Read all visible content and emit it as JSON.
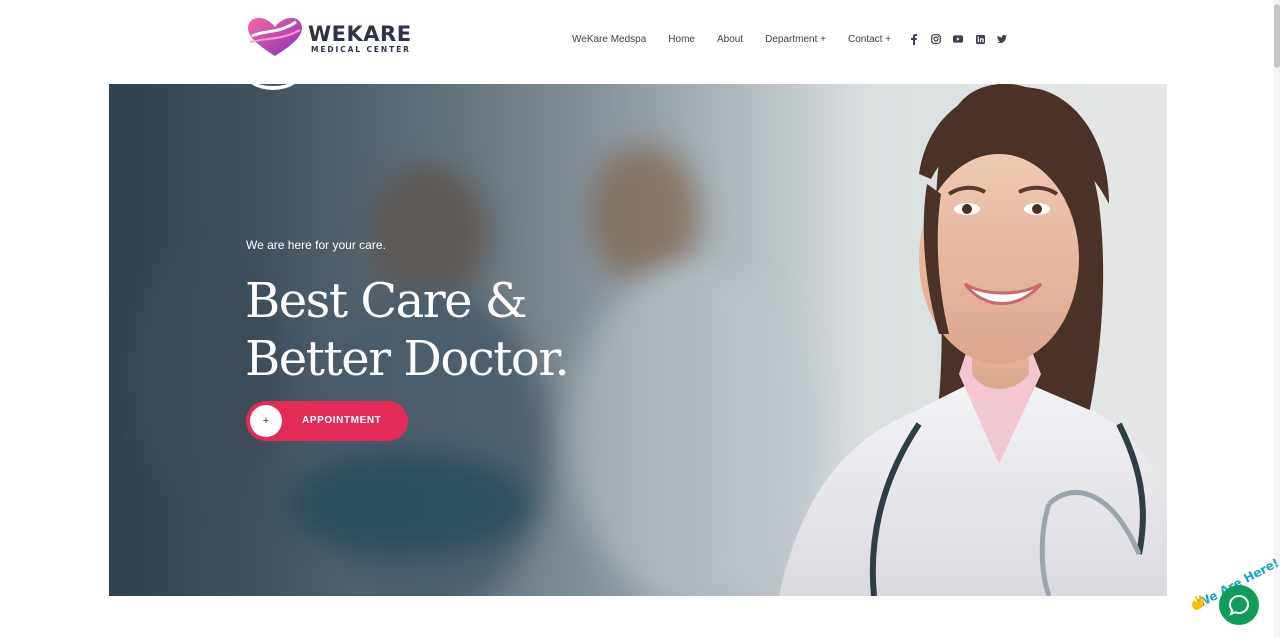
{
  "header": {
    "logo": {
      "title": "WEKARE",
      "subtitle": "MEDICAL CENTER"
    },
    "nav": [
      {
        "label": "WeKare Medspa"
      },
      {
        "label": "Home"
      },
      {
        "label": "About"
      },
      {
        "label": "Department +"
      },
      {
        "label": "Contact +"
      }
    ],
    "social": [
      "facebook-icon",
      "instagram-icon",
      "youtube-icon",
      "linkedin-icon",
      "twitter-icon"
    ]
  },
  "hero": {
    "subtitle": "We are here for your care.",
    "headline_line1": "Best Care &",
    "headline_line2": "Better Doctor.",
    "button": {
      "icon": "+",
      "label": "APPOINTMENT"
    }
  },
  "chat_widget": {
    "tagline": "We Are Here!"
  },
  "colors": {
    "accent": "#e32b58",
    "nav_text": "#3b4150",
    "chat_green": "#0f9d58",
    "logo_pink": "#d4307e"
  }
}
